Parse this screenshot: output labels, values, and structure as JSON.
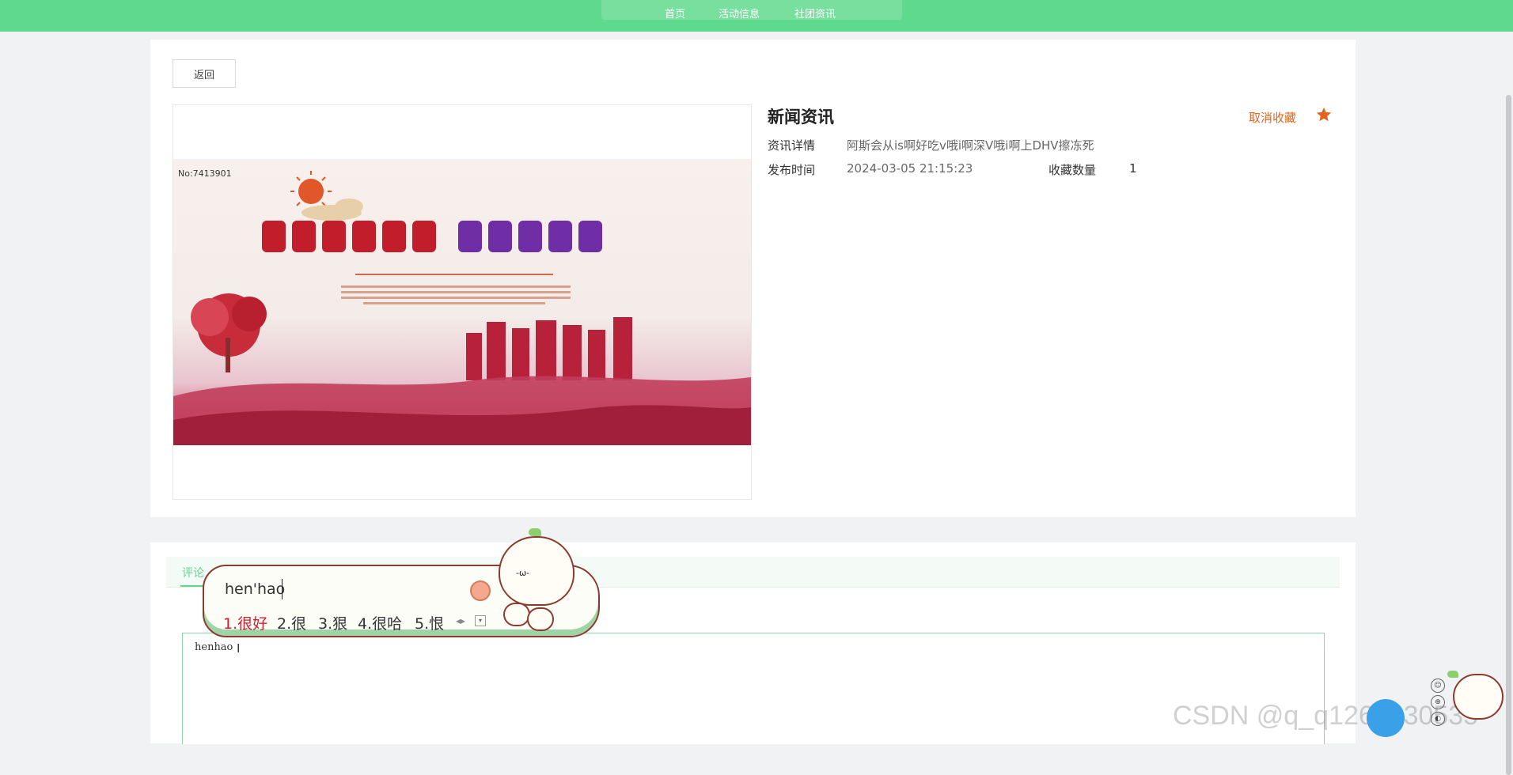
{
  "nav": {
    "items": [
      "首页",
      "活动信息",
      "社团资讯"
    ]
  },
  "detail": {
    "back_label": "返回",
    "image_no": "No:7413901",
    "title": "新闻资讯",
    "fav_cancel_label": "取消收藏",
    "labels": {
      "content": "资讯详情",
      "publish_time": "发布时间",
      "fav_count": "收藏数量"
    },
    "content": "阿斯会从is啊好吃v哦i啊深V哦i啊上DHV擦冻死",
    "publish_time": "2024-03-05 21:15:23",
    "fav_count": "1"
  },
  "comments": {
    "tab_label": "评论",
    "input_value": "henhao"
  },
  "ime": {
    "input": "hen'hao",
    "candidates": [
      "1.很好",
      "2.很",
      "3.狠",
      "4.很哈",
      "5.恨"
    ]
  },
  "widgets": {
    "float_button_label": "",
    "watermark": "CSDN @q_q1262330535"
  },
  "colors": {
    "brand_green": "#5fd98d",
    "favorite_orange": "#e0661f",
    "ime_candidate_red": "#d0202f"
  },
  "icons": {
    "favorite": "star-icon",
    "ime_logo": "ime-logo-icon"
  }
}
